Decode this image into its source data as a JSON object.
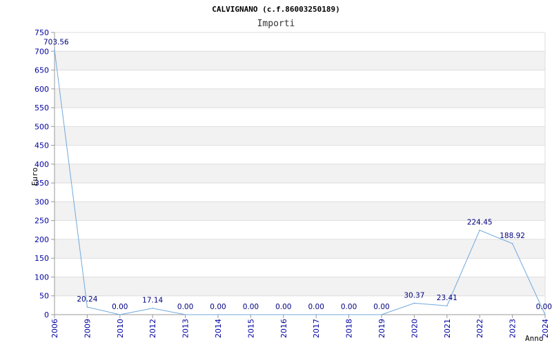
{
  "colors": {
    "line": "#6fa8dc",
    "band": "#f2f2f2",
    "grid": "#dddddd",
    "axis": "#999999",
    "tick_text": "#0000a0",
    "label_text": "#000080"
  },
  "chart_data": {
    "type": "line",
    "title": "CALVIGNANO (c.f.86003250189)",
    "subtitle": "Importi",
    "xlabel": "Anno",
    "ylabel": "Euro",
    "ylim": [
      0,
      750
    ],
    "yticks": [
      0,
      50,
      100,
      150,
      200,
      250,
      300,
      350,
      400,
      450,
      500,
      550,
      600,
      650,
      700,
      750
    ],
    "grid": true,
    "legend": "none",
    "categories": [
      "2006",
      "2009",
      "2010",
      "2012",
      "2013",
      "2014",
      "2015",
      "2016",
      "2017",
      "2018",
      "2019",
      "2020",
      "2021",
      "2022",
      "2023",
      "2024"
    ],
    "values": [
      703.56,
      20.24,
      0.0,
      17.14,
      0.0,
      0.0,
      0.0,
      0.0,
      0.0,
      0.0,
      0.0,
      30.37,
      23.41,
      224.45,
      188.92,
      0.0
    ],
    "value_labels": [
      "703.56",
      "20.24",
      "0.00",
      "17.14",
      "0.00",
      "0.00",
      "0.00",
      "0.00",
      "0.00",
      "0.00",
      "0.00",
      "30.37",
      "23.41",
      "224.45",
      "188.92",
      "0.00"
    ]
  }
}
